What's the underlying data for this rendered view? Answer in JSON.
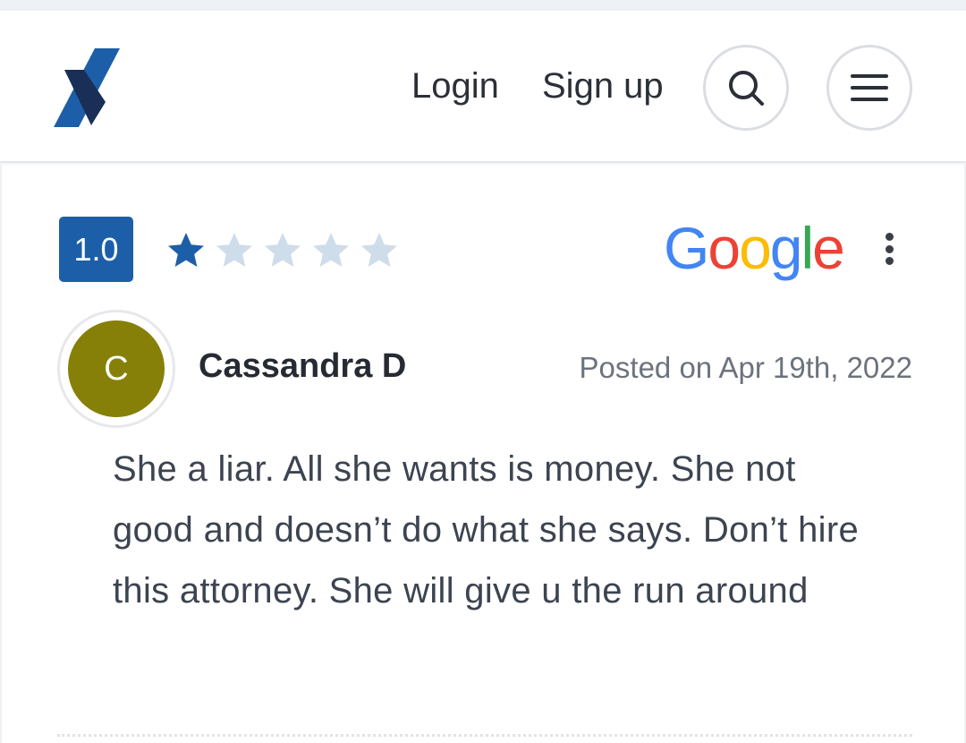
{
  "header": {
    "logo": "x-logo",
    "login_label": "Login",
    "signup_label": "Sign up",
    "search_icon": "search-icon",
    "menu_icon": "hamburger-menu-icon"
  },
  "review": {
    "rating": "1.0",
    "stars_filled": 1,
    "stars_total": 5,
    "source": "Google",
    "reviewer_initial": "C",
    "reviewer_name": "Cassandra D",
    "posted": "Posted on Apr 19th, 2022",
    "text": "She a liar. All she wants is money. She not good and doesn’t do what she says. Don’t hire this attorney. She will give u the run around"
  },
  "colors": {
    "accent": "#1c5fa8",
    "star_filled": "#1c5fa8",
    "star_empty": "#cfdcea",
    "avatar_bg": "#868008",
    "google_blue": "#4285F4",
    "google_red": "#EA4335",
    "google_yellow": "#FBBC05",
    "google_green": "#34A853"
  }
}
